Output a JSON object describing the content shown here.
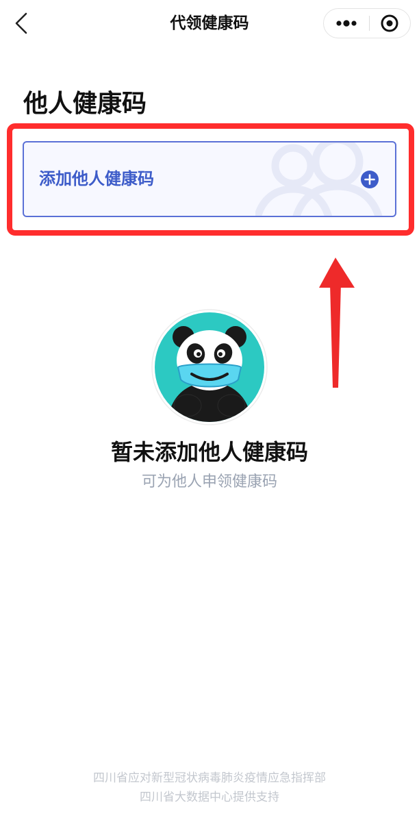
{
  "nav": {
    "title": "代领健康码"
  },
  "section": {
    "title": "他人健康码"
  },
  "add_card": {
    "label": "添加他人健康码"
  },
  "empty_state": {
    "title": "暂未添加他人健康码",
    "subtitle": "可为他人申领健康码"
  },
  "footer": {
    "line1": "四川省应对新型冠状病毒肺炎疫情应急指挥部",
    "line2": "四川省大数据中心提供支持"
  },
  "colors": {
    "accent": "#3d5cc9",
    "highlight": "#ff2d2d",
    "panda_bg": "#2cc9c2"
  }
}
